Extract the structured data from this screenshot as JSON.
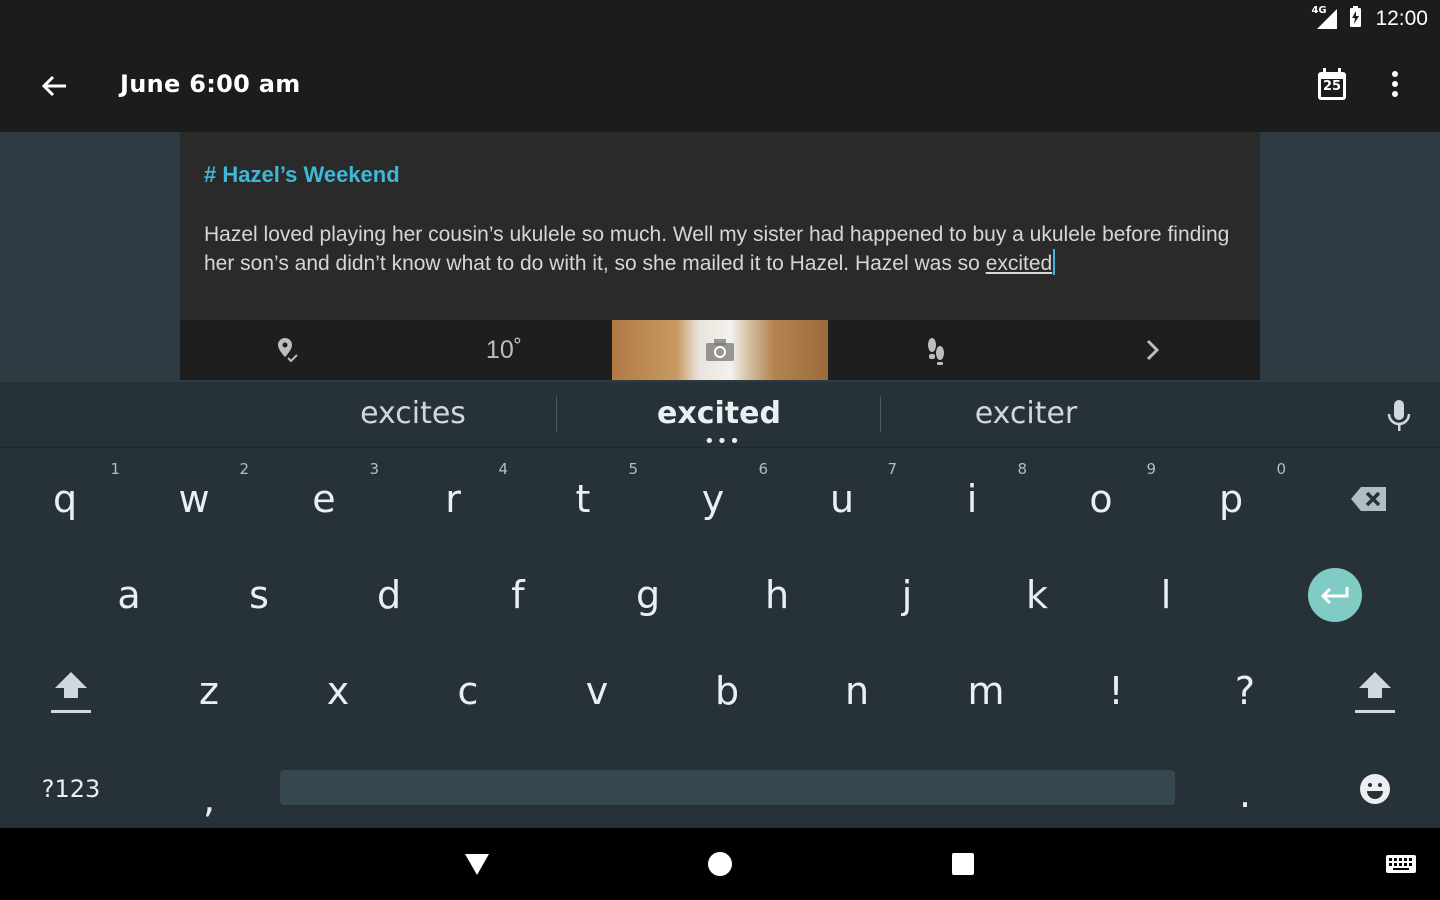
{
  "status_bar": {
    "network": "4G",
    "time": "12:00"
  },
  "app_bar": {
    "title": "June 6:00 am",
    "calendar_day": "25"
  },
  "entry": {
    "tag": "# Hazel’s Weekend",
    "body_before": "Hazel loved playing her cousin’s ukulele so much. Well my sister had happened to buy a ukulele before finding her son’s and didn’t know what to do with it, so she mailed it to Hazel. Hazel was so ",
    "body_current_word": "excited"
  },
  "entry_toolbar": {
    "temperature": "10˚"
  },
  "keyboard": {
    "suggestions": [
      "excites",
      "excited",
      "exciter"
    ],
    "row1": [
      {
        "key": "q",
        "hint": "1"
      },
      {
        "key": "w",
        "hint": "2"
      },
      {
        "key": "e",
        "hint": "3"
      },
      {
        "key": "r",
        "hint": "4"
      },
      {
        "key": "t",
        "hint": "5"
      },
      {
        "key": "y",
        "hint": "6"
      },
      {
        "key": "u",
        "hint": "7"
      },
      {
        "key": "i",
        "hint": "8"
      },
      {
        "key": "o",
        "hint": "9"
      },
      {
        "key": "p",
        "hint": "0"
      }
    ],
    "row2": [
      "a",
      "s",
      "d",
      "f",
      "g",
      "h",
      "j",
      "k",
      "l"
    ],
    "row3": [
      "z",
      "x",
      "c",
      "v",
      "b",
      "n",
      "m",
      "!",
      "?"
    ],
    "symbols_label": "?123",
    "comma": ",",
    "period": ".",
    "accent_color": "#80cbc4"
  },
  "colors": {
    "tag": "#3fb8d8",
    "keyboard_bg": "#263238",
    "content_bg": "#2f3b43"
  }
}
